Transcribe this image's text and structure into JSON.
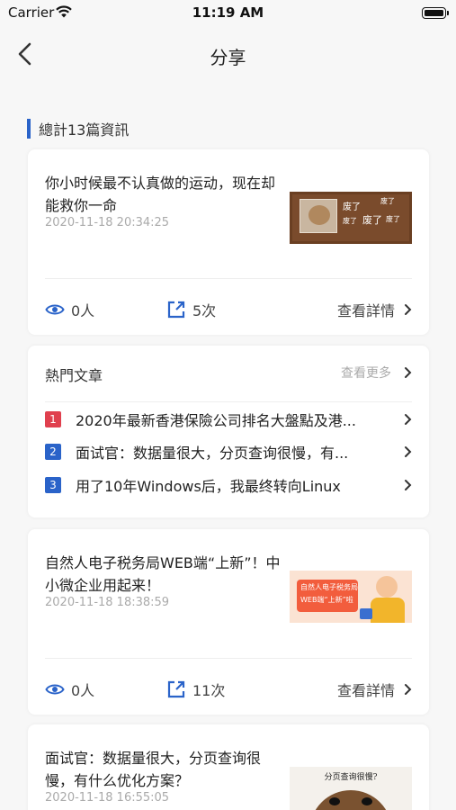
{
  "status_bar": {
    "carrier": "Carrier",
    "time": "11:19 AM"
  },
  "nav": {
    "title": "分享"
  },
  "section": {
    "label": "總計13篇資訊"
  },
  "articles": [
    {
      "title": "你小时候最不认真做的运动，现在却能救你一命",
      "date": "2020-11-18 20:34:25",
      "views": "0人",
      "shares": "5次",
      "detail": "查看詳情",
      "thumb_texts": [
        "废了",
        "废了",
        "废了",
        "废了",
        "废了"
      ]
    },
    {
      "title": "自然人电子税务局WEB端“上新”！中小微企业用起来！",
      "date": "2020-11-18 18:38:59",
      "views": "0人",
      "shares": "11次",
      "detail": "查看詳情",
      "thumb_texts": [
        "自然人电子税务局",
        "WEB端“上新”啦"
      ]
    },
    {
      "title": "面试官：数据量很大，分页查询很慢，有什么优化方案？",
      "date": "2020-11-18 16:55:05",
      "thumb_texts": [
        "分页查询很慢?"
      ]
    }
  ],
  "hot": {
    "title": "熱門文章",
    "more": "查看更多",
    "items": [
      {
        "num": "1",
        "text": "2020年最新香港保險公司排名大盤點及港...",
        "color": "#e0404e"
      },
      {
        "num": "2",
        "text": "面试官：数据量很大，分页查询很慢，有...",
        "color": "#2a63c9"
      },
      {
        "num": "3",
        "text": "用了10年Windows后，我最终转向Linux",
        "color": "#2a63c9"
      }
    ]
  },
  "colors": {
    "accent": "#2a63c9",
    "rank1": "#e0404e"
  }
}
